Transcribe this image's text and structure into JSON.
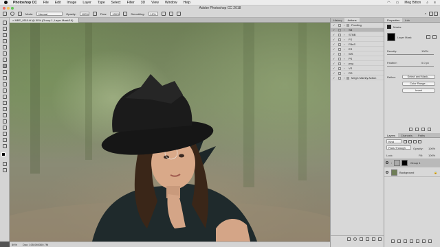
{
  "menubar": {
    "app": "Photoshop CC",
    "items": [
      "File",
      "Edit",
      "Image",
      "Layer",
      "Type",
      "Select",
      "Filter",
      "3D",
      "View",
      "Window",
      "Help"
    ],
    "user": "Meg Bitton"
  },
  "window": {
    "title": "Adobe Photoshop CC 2018"
  },
  "options": {
    "mode_label": "Mode:",
    "mode_value": "Normal",
    "opacity_label": "Opacity:",
    "opacity_value": "100%",
    "flow_label": "Flow:",
    "flow_value": "100%",
    "smoothing_label": "Smoothing:",
    "smoothing_value": "10%"
  },
  "document": {
    "tab_label": "MBP_9510.tif @ 50% (Group 1, Layer Mask/16)",
    "zoom": "50%",
    "doc_info": "Doc: 105.0M/300.7M"
  },
  "history_actions": {
    "tabs": [
      "History",
      "Actions"
    ],
    "rows": [
      {
        "name": "Proofing",
        "checked": true,
        "folder": true,
        "selected": false
      },
      {
        "name": "SB",
        "checked": true,
        "folder": false,
        "selected": true
      },
      {
        "name": "STBB",
        "checked": true,
        "folder": false,
        "selected": false
      },
      {
        "name": "FS",
        "checked": true,
        "folder": false,
        "selected": false
      },
      {
        "name": "FBnS",
        "checked": true,
        "folder": false,
        "selected": false
      },
      {
        "name": "ES",
        "checked": true,
        "folder": false,
        "selected": false
      },
      {
        "name": "WS",
        "checked": true,
        "folder": false,
        "selected": false
      },
      {
        "name": "PS",
        "checked": true,
        "folder": false,
        "selected": false
      },
      {
        "name": "png",
        "checked": true,
        "folder": false,
        "selected": false
      },
      {
        "name": "VS",
        "checked": true,
        "folder": false,
        "selected": false
      },
      {
        "name": "RS",
        "checked": true,
        "folder": false,
        "selected": false
      },
      {
        "name": "Meg's Mamily Action",
        "checked": true,
        "folder": true,
        "selected": false
      }
    ]
  },
  "properties": {
    "tabs": [
      "Properties",
      "Info"
    ],
    "header": "Masks",
    "layer_mask_label": "Layer Mask",
    "density_label": "Density:",
    "density_value": "100%",
    "feather_label": "Feather:",
    "feather_value": "0.0 px",
    "refine_label": "Refine:",
    "select_mask_button": "Select and Mask...",
    "color_range_button": "Color Range...",
    "invert_button": "Invert"
  },
  "layers": {
    "tabs": [
      "Layers",
      "Channels",
      "Paths"
    ],
    "kind_label": "Kind",
    "blend_mode": "Pass Through",
    "opacity_label": "Opacity:",
    "opacity_value": "100%",
    "lock_label": "Lock:",
    "fill_label": "Fill:",
    "fill_value": "100%",
    "items": [
      {
        "name": "Group 1",
        "selected": true
      },
      {
        "name": "Background",
        "selected": false
      }
    ]
  }
}
